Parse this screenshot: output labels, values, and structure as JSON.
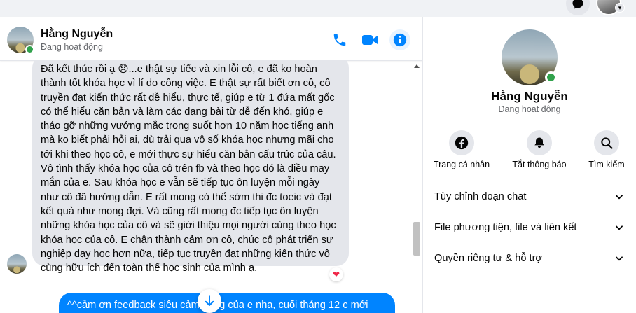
{
  "contact": {
    "name": "Hằng Nguyễn",
    "status": "Đang hoạt động"
  },
  "messages": {
    "incoming_paragraphs": [
      "Đã kết thúc rồi ạ 😞...e thật sự tiếc và xin lỗi cô, e đã ko hoàn thành tốt khóa học vì lí do công việc. E thật sự rất biết ơn cô, cô truyền đạt kiến thức rất dễ hiểu, thực tế, giúp e từ 1 đứa mất gốc có thể hiểu căn bản và làm các dạng bài từ dễ đến khó, giúp e tháo gỡ những vướng mắc trong suốt hơn 10 năm học tiếng anh mà ko biết phải hỏi ai, dù trải qua vô số khóa học nhưng mãi cho tới khi theo học cô, e mới thực sự hiểu căn bản cấu trúc của câu.",
      "Vô tình thấy khóa học của cô trên fb và theo học đó là điều may mắn của e. Sau khóa học e vẫn sẽ tiếp tục ôn luyện mỗi ngày như cô đã hướng dẫn. E rất mong có thể sớm thi đc toeic và đạt kết quả như mong đợi. Và cũng rất mong đc tiếp tục ôn luyện những khóa học của cô và sẽ giới thiệu mọi người cùng theo học khóa học của cô. E chân thành cảm ơn cô, chúc cô phát triển sự nghiệp dạy học hơn nữa, tiếp tục truyền đạt những kiến thức vô cùng hữu ích đến toàn thể học sinh của mình ạ."
    ],
    "reaction": "❤",
    "outgoing_text": "^^cảm ơn feedback siêu cảm động của e nha, cuối tháng 12 c mới"
  },
  "panel": {
    "actions": [
      {
        "label": "Trang cá nhân",
        "icon": "facebook-icon"
      },
      {
        "label": "Tắt thông báo",
        "icon": "bell-icon"
      },
      {
        "label": "Tìm kiếm",
        "icon": "search-icon"
      }
    ],
    "sections": [
      {
        "label": "Tùy chỉnh đoạn chat"
      },
      {
        "label": "File phương tiện, file và liên kết"
      },
      {
        "label": "Quyền riêng tư & hỗ trợ"
      }
    ]
  },
  "colors": {
    "accent": "#0084ff",
    "online": "#31a24c",
    "incoming_bubble": "#e4e6eb",
    "reaction_heart": "#f02849"
  }
}
